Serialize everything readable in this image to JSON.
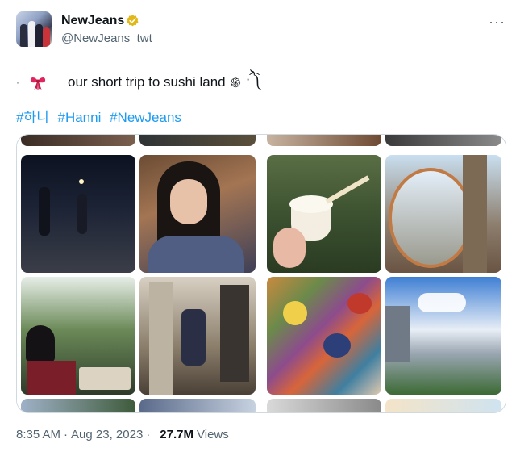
{
  "account": {
    "name": "NewJeans",
    "handle": "@NewJeans_twt",
    "verified_badge_color": "#e2b719"
  },
  "menu": {
    "more_label": "···"
  },
  "tweet": {
    "bullet": "·",
    "bow_icon": "ribbon-bow-icon",
    "text": "our short trip to sushi land",
    "spiral_glyph": "֍",
    "emoticon": "·͡༽",
    "hashtags": [
      "#하니",
      "#Hanni",
      "#NewJeans"
    ]
  },
  "photos": {
    "count": 2,
    "left_descriptions": [
      "night street",
      "selfie blue sweater",
      "canal tree",
      "closet mirror"
    ],
    "right_descriptions": [
      "ice cream cup",
      "round mirror street",
      "paint palette",
      "city skyline"
    ]
  },
  "footer": {
    "time": "8:35 AM",
    "separator": "·",
    "date": "Aug 23, 2023",
    "views_count": "27.7M",
    "views_label": "Views"
  },
  "colors": {
    "link": "#1d9bf0",
    "muted": "#536471",
    "text": "#0f1419"
  }
}
